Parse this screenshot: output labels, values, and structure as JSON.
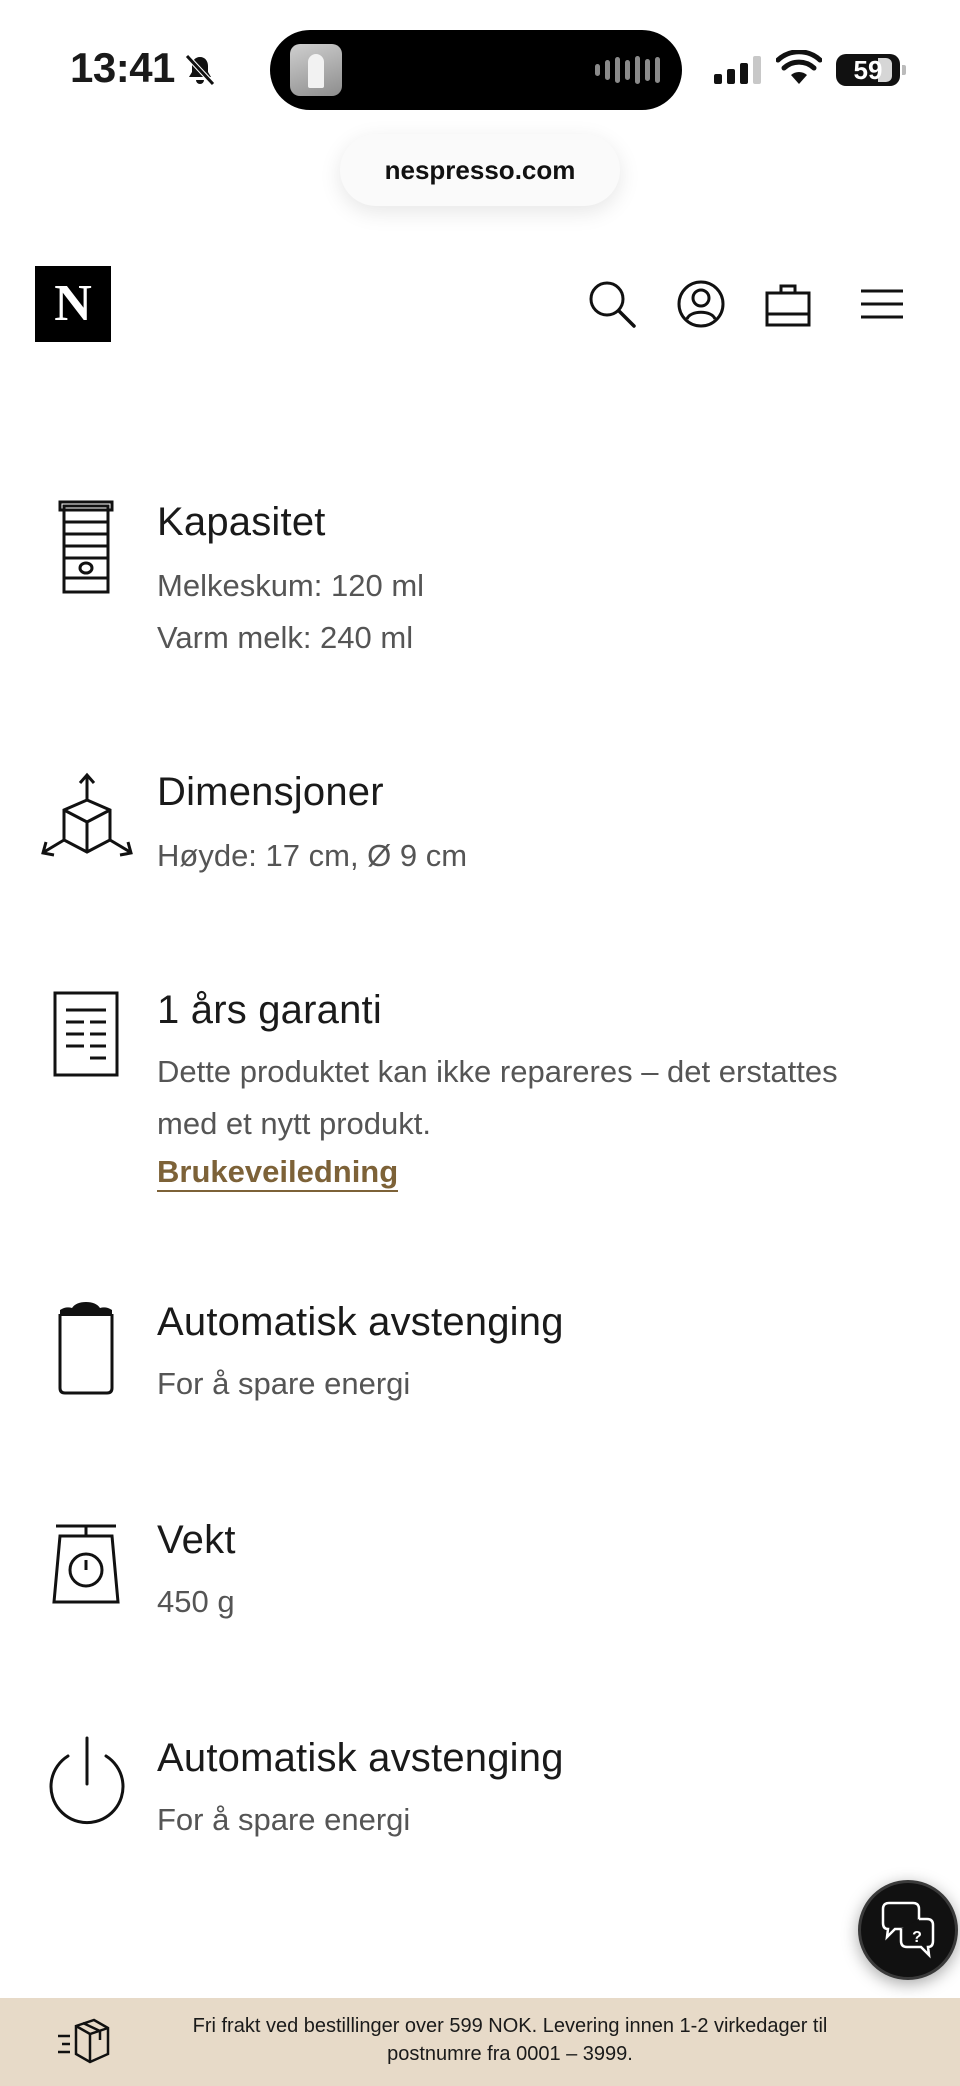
{
  "status_bar": {
    "time": "13:41",
    "battery": "59"
  },
  "browser": {
    "url": "nespresso.com"
  },
  "header": {
    "logo_letter": "N"
  },
  "specs": [
    {
      "icon": "capacity-icon",
      "title": "Kapasitet",
      "lines": [
        "Melkeskum: 120 ml",
        "Varm melk: 240 ml"
      ]
    },
    {
      "icon": "dimensions-cube-icon",
      "title": "Dimensjoner",
      "lines": [
        "Høyde: 17 cm, Ø 9 cm"
      ]
    },
    {
      "icon": "warranty-document-icon",
      "title": "1 års garanti",
      "lines": [
        "Dette produktet kan ikke repareres – det erstattes",
        "med et nytt produkt."
      ],
      "link": "Brukeveiledning"
    },
    {
      "icon": "jug-icon",
      "title": "Automatisk avstenging",
      "lines": [
        "For å spare energi"
      ]
    },
    {
      "icon": "scale-icon",
      "title": "Vekt",
      "lines": [
        "450 g"
      ]
    },
    {
      "icon": "power-icon",
      "title": "Automatisk avstenging",
      "lines": [
        "For å spare energi"
      ]
    }
  ],
  "banner": {
    "text": "Fri frakt ved bestillinger over 599 NOK. Levering innen 1-2 virkedager til postnumre fra 0001 – 3999."
  },
  "colors": {
    "link": "#7d6238",
    "banner_bg": "#e7dac8"
  }
}
